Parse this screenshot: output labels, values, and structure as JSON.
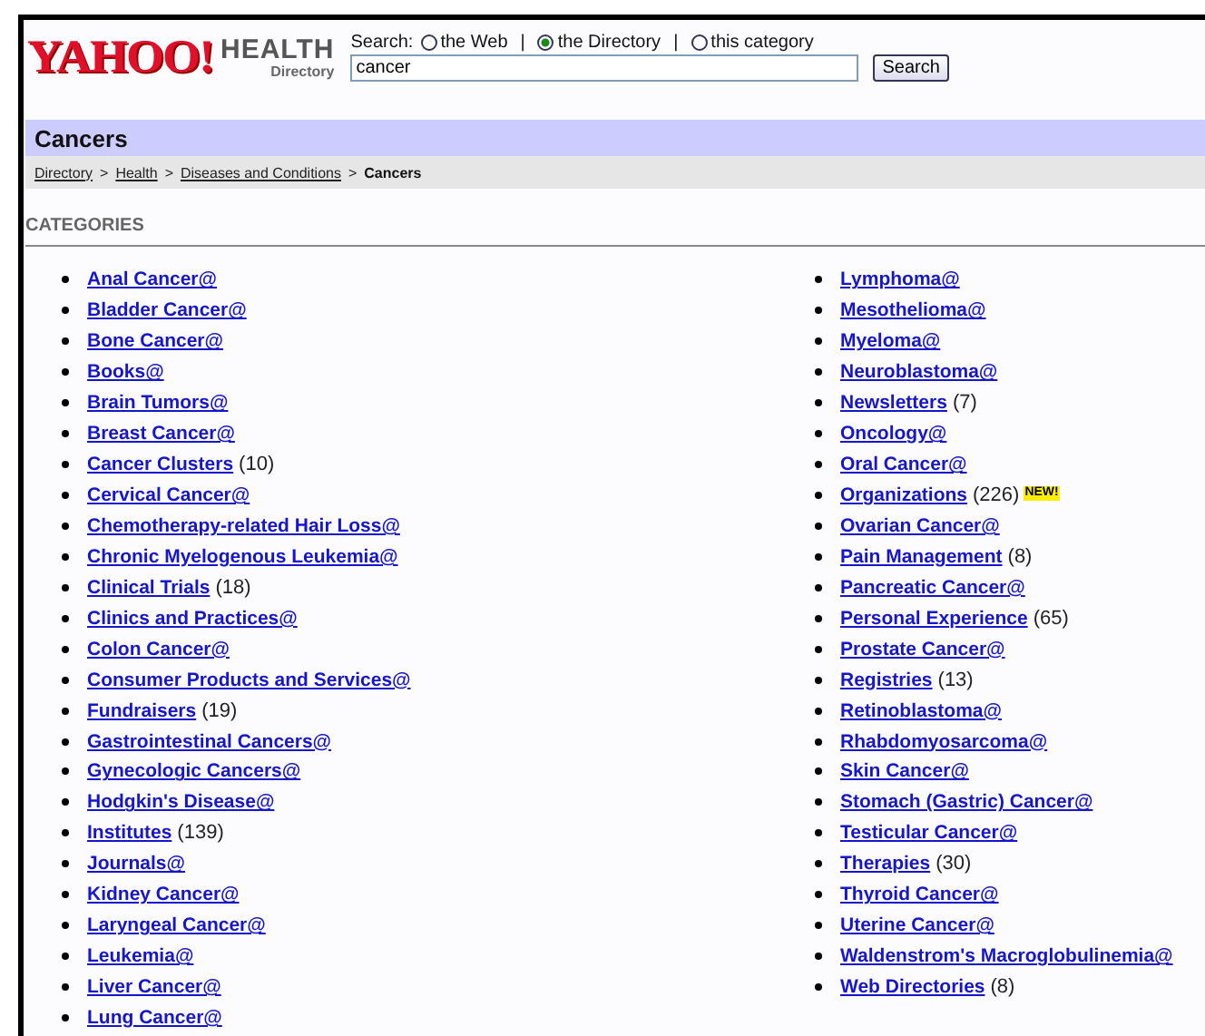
{
  "logo": {
    "brand": "YAHOO!",
    "section": "HEALTH",
    "subsection": "Directory"
  },
  "search": {
    "label": "Search:",
    "separator": "|",
    "options": [
      {
        "label": "the Web",
        "selected": false
      },
      {
        "label": "the Directory",
        "selected": true
      },
      {
        "label": "this category",
        "selected": false
      }
    ],
    "value": "cancer",
    "button": "Search"
  },
  "page_title": "Cancers",
  "breadcrumb": {
    "separator": ">",
    "items": [
      {
        "label": "Directory",
        "kind": "link"
      },
      {
        "label": "Health",
        "kind": "link"
      },
      {
        "label": "Diseases and Conditions",
        "kind": "link"
      },
      {
        "label": "Cancers",
        "kind": "current"
      }
    ]
  },
  "section_heading": "CATEGORIES",
  "columns": [
    [
      {
        "label": "Anal Cancer@"
      },
      {
        "label": "Bladder Cancer@"
      },
      {
        "label": "Bone Cancer@"
      },
      {
        "label": "Books@"
      },
      {
        "label": "Brain Tumors@"
      },
      {
        "label": "Breast Cancer@"
      },
      {
        "label": "Cancer Clusters",
        "count": "(10)"
      },
      {
        "label": "Cervical Cancer@"
      },
      {
        "label": "Chemotherapy-related Hair Loss@"
      },
      {
        "label": "Chronic Myelogenous Leukemia@"
      },
      {
        "label": "Clinical Trials",
        "count": "(18)"
      },
      {
        "label": "Clinics and Practices@"
      },
      {
        "label": "Colon Cancer@"
      },
      {
        "label": "Consumer Products and Services@"
      },
      {
        "label": "Fundraisers",
        "count": "(19)"
      },
      {
        "label": "Gastrointestinal Cancers@"
      },
      {
        "label": "Gynecologic Cancers@"
      },
      {
        "label": "Hodgkin's Disease@"
      },
      {
        "label": "Institutes",
        "count": "(139)"
      },
      {
        "label": "Journals@"
      },
      {
        "label": "Kidney Cancer@"
      },
      {
        "label": "Laryngeal Cancer@"
      },
      {
        "label": "Leukemia@"
      },
      {
        "label": "Liver Cancer@"
      },
      {
        "label": "Lung Cancer@"
      }
    ],
    [
      {
        "label": "Lymphoma@"
      },
      {
        "label": "Mesothelioma@"
      },
      {
        "label": "Myeloma@"
      },
      {
        "label": "Neuroblastoma@"
      },
      {
        "label": "Newsletters",
        "count": "(7)"
      },
      {
        "label": "Oncology@"
      },
      {
        "label": "Oral Cancer@"
      },
      {
        "label": "Organizations",
        "count": "(226)",
        "badge": "NEW!"
      },
      {
        "label": "Ovarian Cancer@"
      },
      {
        "label": "Pain Management",
        "count": "(8)"
      },
      {
        "label": "Pancreatic Cancer@"
      },
      {
        "label": "Personal Experience",
        "count": "(65)"
      },
      {
        "label": "Prostate Cancer@"
      },
      {
        "label": "Registries",
        "count": "(13)"
      },
      {
        "label": "Retinoblastoma@"
      },
      {
        "label": "Rhabdomyosarcoma@"
      },
      {
        "label": "Skin Cancer@"
      },
      {
        "label": "Stomach (Gastric) Cancer@"
      },
      {
        "label": "Testicular Cancer@"
      },
      {
        "label": "Therapies",
        "count": "(30)"
      },
      {
        "label": "Thyroid Cancer@"
      },
      {
        "label": "Uterine Cancer@"
      },
      {
        "label": "Waldenstrom's Macroglobulinemia@"
      },
      {
        "label": "Web Directories",
        "count": "(8)"
      }
    ]
  ]
}
